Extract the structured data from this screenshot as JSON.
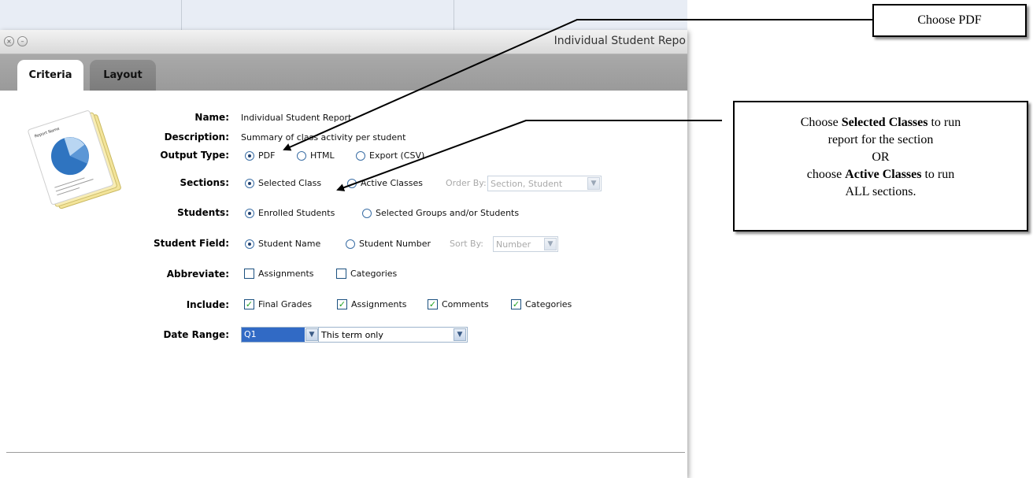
{
  "window": {
    "title": "Individual Student Repo",
    "close_glyph": "×",
    "minimize_glyph": "–"
  },
  "tabs": [
    {
      "label": "Criteria",
      "active": true
    },
    {
      "label": "Layout",
      "active": false
    }
  ],
  "form": {
    "name": {
      "label": "Name:",
      "value": "Individual Student Report"
    },
    "description": {
      "label": "Description:",
      "value": "Summary of class activity per student"
    },
    "output_type": {
      "label": "Output Type:",
      "options": [
        "PDF",
        "HTML",
        "Export (CSV)"
      ],
      "selected": "PDF"
    },
    "sections": {
      "label": "Sections:",
      "options": [
        "Selected Class",
        "Active Classes"
      ],
      "selected": "Selected Class",
      "order_by_label": "Order By:",
      "order_by_value": "Section, Student"
    },
    "students": {
      "label": "Students:",
      "options": [
        "Enrolled Students",
        "Selected Groups and/or Students"
      ],
      "selected": "Enrolled Students"
    },
    "student_field": {
      "label": "Student Field:",
      "options": [
        "Student Name",
        "Student Number"
      ],
      "selected": "Student Name",
      "sort_by_label": "Sort By:",
      "sort_by_value": "Number"
    },
    "abbreviate": {
      "label": "Abbreviate:",
      "options": [
        {
          "label": "Assignments",
          "checked": false
        },
        {
          "label": "Categories",
          "checked": false
        }
      ]
    },
    "include": {
      "label": "Include:",
      "options": [
        {
          "label": "Final Grades",
          "checked": true
        },
        {
          "label": "Assignments",
          "checked": true
        },
        {
          "label": "Comments",
          "checked": true
        },
        {
          "label": "Categories",
          "checked": true
        }
      ]
    },
    "date_range": {
      "label": "Date Range:",
      "term": "Q1",
      "scope": "This term only"
    }
  },
  "report_icon": {
    "title": "Report Name"
  },
  "callouts": {
    "pdf": "Choose PDF",
    "sections": {
      "line1_pre": "Choose ",
      "line1_bold": "Selected Classes",
      "line1_post": " to run",
      "line2": "report for the section",
      "line3": "OR",
      "line4_pre": "choose ",
      "line4_bold": "Active Classes",
      "line4_post": " to run",
      "line5": "ALL sections."
    }
  },
  "colors": {
    "selection_blue": "#316ac5",
    "check_green": "#21a121",
    "tab_bar_gray": "#9e9e9e"
  }
}
